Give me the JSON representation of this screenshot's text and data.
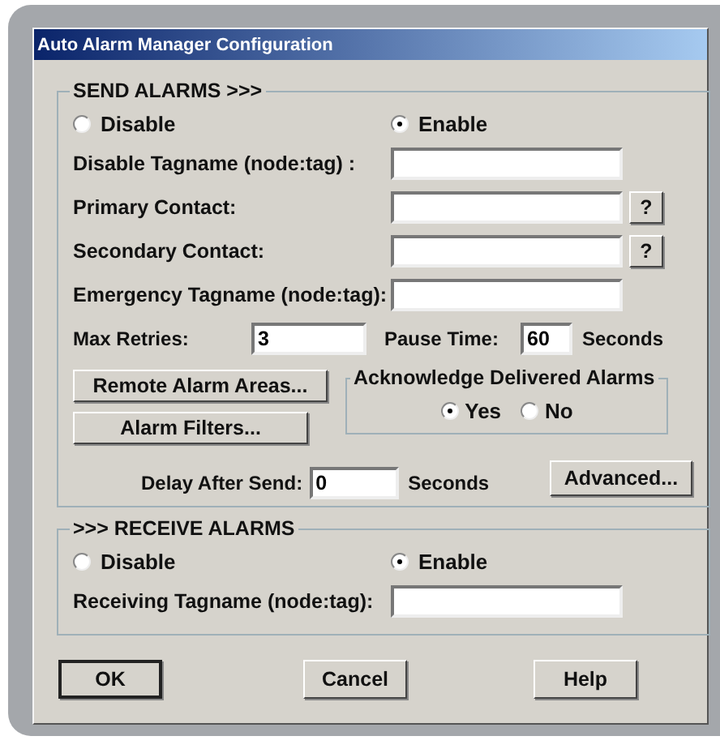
{
  "window": {
    "title": "Auto Alarm Manager Configuration"
  },
  "send_alarms": {
    "title": "SEND ALARMS >>>",
    "options": [
      {
        "label": "Disable",
        "selected": false
      },
      {
        "label": "Enable",
        "selected": true
      }
    ],
    "fields": [
      {
        "label": "Disable Tagname (node:tag) :"
      },
      {
        "label": "Primary Contact:",
        "help_button": "?"
      },
      {
        "label": "Secondary Contact:",
        "help_button": "?"
      },
      {
        "label": "Emergency Tagname (node:tag):"
      }
    ],
    "max_retries": {
      "label": "Max Retries:",
      "value": "3"
    },
    "pause_time": {
      "label": "Pause Time:",
      "value": "60",
      "unit": "Seconds"
    },
    "buttons": [
      "Remote Alarm Areas...",
      "Alarm Filters..."
    ],
    "acknowledge": {
      "title": "Acknowledge Delivered Alarms",
      "options": [
        {
          "label": "Yes",
          "selected": true
        },
        {
          "label": "No",
          "selected": false
        }
      ]
    },
    "delay": {
      "label": "Delay After Send:",
      "value": "0",
      "unit": "Seconds"
    },
    "advanced_button": "Advanced..."
  },
  "receive_alarms": {
    "title": ">>> RECEIVE ALARMS",
    "options": [
      {
        "label": "Disable",
        "selected": false
      },
      {
        "label": "Enable",
        "selected": true
      }
    ],
    "fields": [
      {
        "label": "Receiving Tagname (node:tag):"
      }
    ]
  },
  "buttons": [
    {
      "label": "OK",
      "default": true
    },
    {
      "label": "Cancel",
      "default": false
    },
    {
      "label": "Help",
      "default": false
    }
  ]
}
